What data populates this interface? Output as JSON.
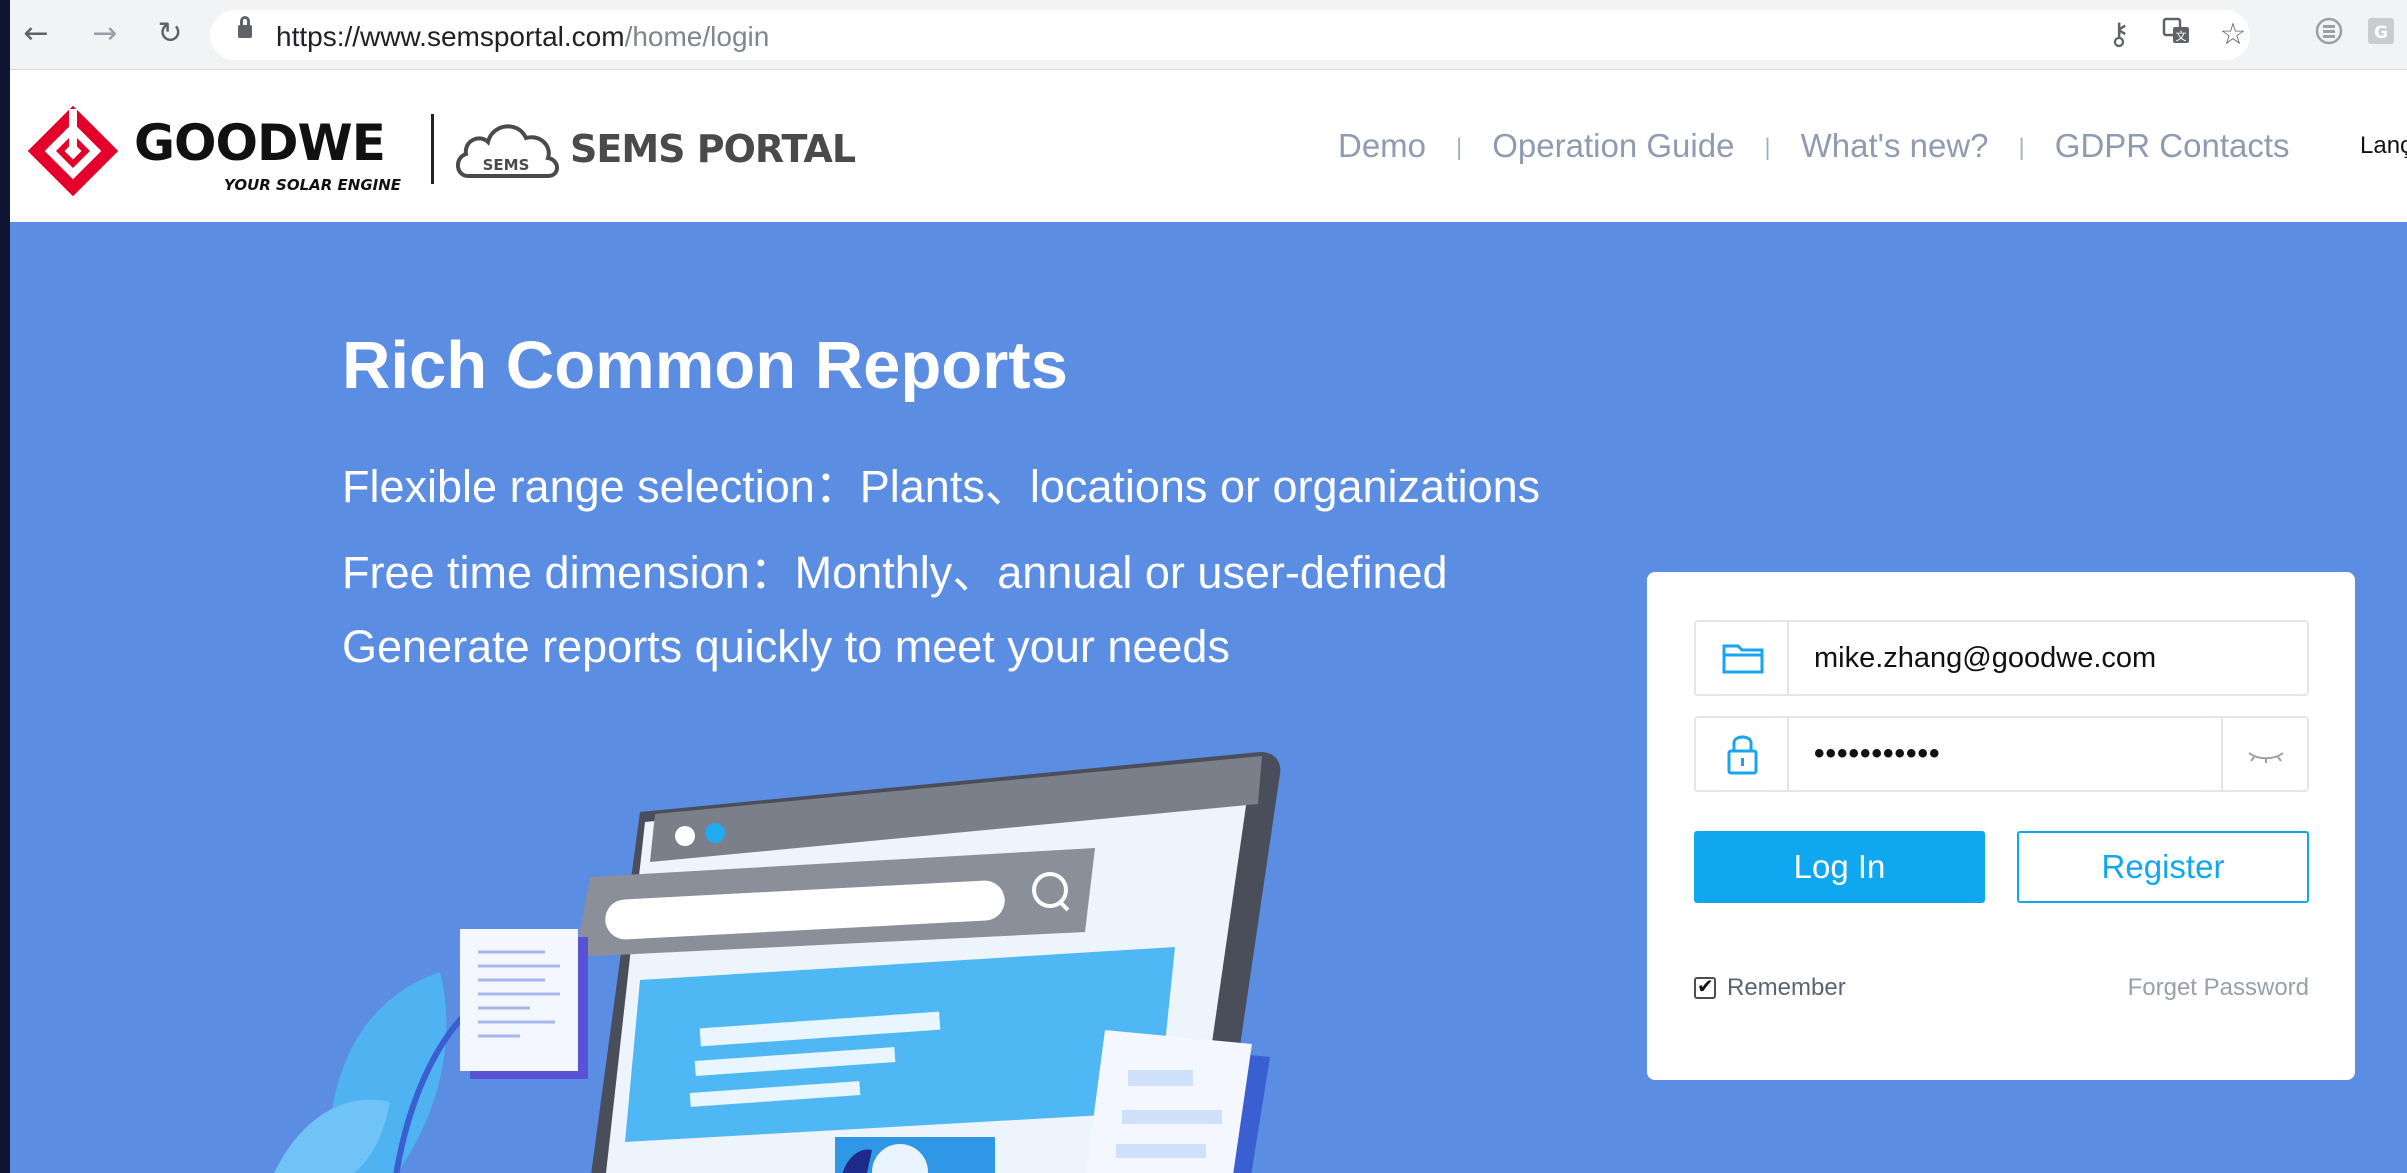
{
  "browser": {
    "url_host": "https://www.semsportal.com",
    "url_path": "/home/login"
  },
  "header": {
    "brand": "GOODWE",
    "tagline": "YOUR SOLAR ENGINE",
    "cloud_label": "SEMS",
    "portal_name": "SEMS PORTAL",
    "nav": [
      {
        "label": "Demo"
      },
      {
        "label": "Operation Guide"
      },
      {
        "label": "What's new?"
      },
      {
        "label": "GDPR Contacts"
      }
    ],
    "nav_separator": "|",
    "language_label": "Lanç"
  },
  "hero": {
    "title": "Rich Common Reports",
    "features": [
      "Flexible range selection：Plants、locations or organizations",
      "Free time dimension：Monthly、annual or user-defined",
      "Generate reports quickly to meet your needs"
    ]
  },
  "login": {
    "username_value": "mike.zhang@goodwe.com",
    "password_value": "•••••••••••",
    "login_label": "Log In",
    "register_label": "Register",
    "remember_label": "Remember",
    "remember_checked": true,
    "forget_label": "Forget Password"
  },
  "colors": {
    "hero_bg": "#5b8de3",
    "accent": "#0fa7f0",
    "brand_red": "#e4002b"
  }
}
